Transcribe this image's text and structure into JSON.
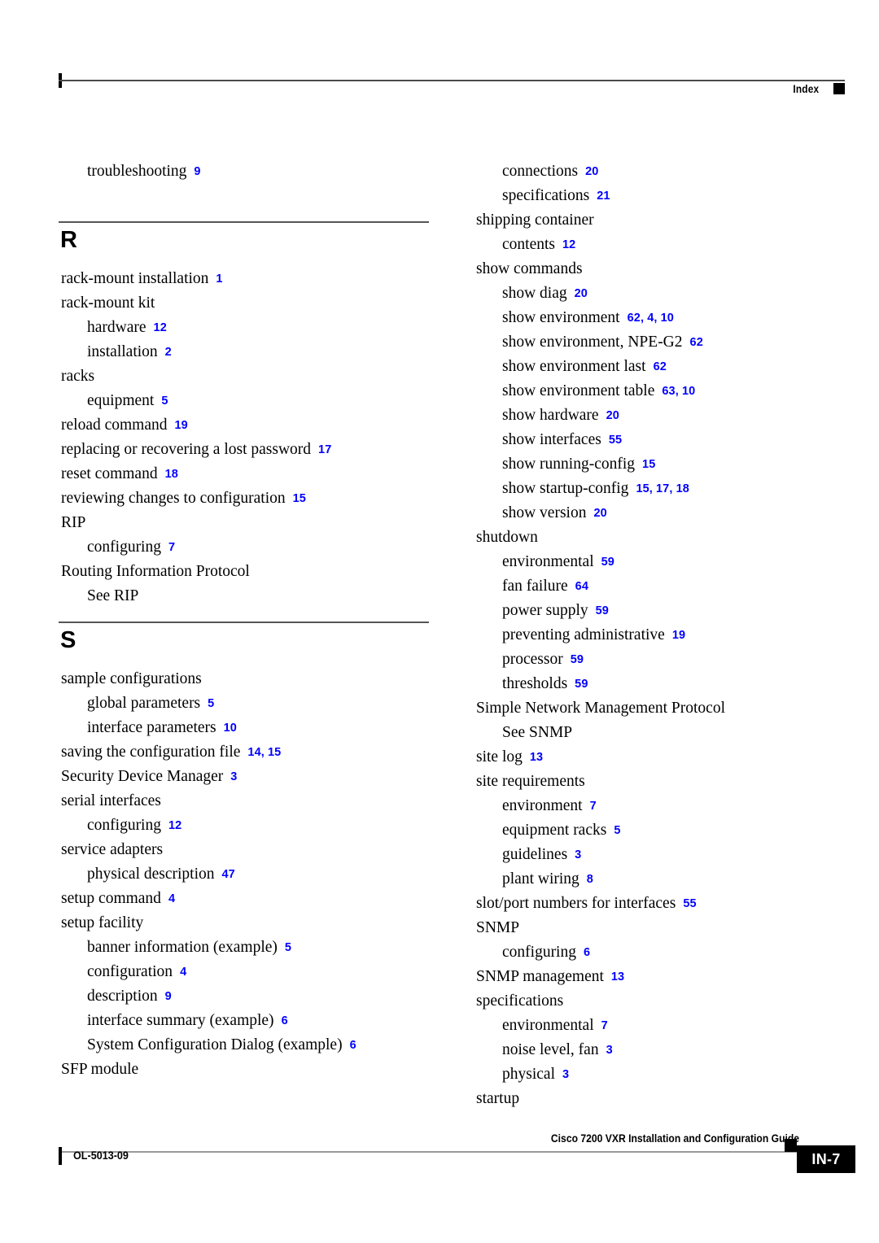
{
  "header": {
    "label": "Index"
  },
  "footer": {
    "guide_title": "Cisco 7200 VXR Installation and Configuration Guide",
    "doc_number": "OL-5013-09",
    "page_number": "IN-7"
  },
  "columns": {
    "left": [
      {
        "kind": "entry",
        "level": 2,
        "term": "troubleshooting",
        "pages": "9"
      },
      {
        "kind": "spacer"
      },
      {
        "kind": "section",
        "letter": "R"
      },
      {
        "kind": "entry",
        "level": 1,
        "term": "rack-mount installation",
        "pages": "1"
      },
      {
        "kind": "entry",
        "level": 1,
        "term": "rack-mount kit",
        "pages": ""
      },
      {
        "kind": "entry",
        "level": 2,
        "term": "hardware",
        "pages": "12"
      },
      {
        "kind": "entry",
        "level": 2,
        "term": "installation",
        "pages": "2"
      },
      {
        "kind": "entry",
        "level": 1,
        "term": "racks",
        "pages": ""
      },
      {
        "kind": "entry",
        "level": 2,
        "term": "equipment",
        "pages": "5"
      },
      {
        "kind": "entry",
        "level": 1,
        "term": "reload command",
        "pages": "19"
      },
      {
        "kind": "entry",
        "level": 1,
        "term": "replacing or recovering a lost password",
        "pages": "17"
      },
      {
        "kind": "entry",
        "level": 1,
        "term": "reset command",
        "pages": "18"
      },
      {
        "kind": "entry",
        "level": 1,
        "term": "reviewing changes to configuration",
        "pages": "15"
      },
      {
        "kind": "entry",
        "level": 1,
        "term": "RIP",
        "pages": ""
      },
      {
        "kind": "entry",
        "level": 2,
        "term": "configuring",
        "pages": "7"
      },
      {
        "kind": "entry",
        "level": 1,
        "term": "Routing Information Protocol",
        "pages": ""
      },
      {
        "kind": "entry",
        "level": 2,
        "term": "See RIP",
        "pages": ""
      },
      {
        "kind": "section",
        "letter": "S"
      },
      {
        "kind": "entry",
        "level": 1,
        "term": "sample configurations",
        "pages": ""
      },
      {
        "kind": "entry",
        "level": 2,
        "term": "global parameters",
        "pages": "5"
      },
      {
        "kind": "entry",
        "level": 2,
        "term": "interface parameters",
        "pages": "10"
      },
      {
        "kind": "entry",
        "level": 1,
        "term": "saving the configuration file",
        "pages": "14, 15"
      },
      {
        "kind": "entry",
        "level": 1,
        "term": "Security Device Manager",
        "pages": "3"
      },
      {
        "kind": "entry",
        "level": 1,
        "term": "serial interfaces",
        "pages": ""
      },
      {
        "kind": "entry",
        "level": 2,
        "term": "configuring",
        "pages": "12"
      },
      {
        "kind": "entry",
        "level": 1,
        "term": "service adapters",
        "pages": ""
      },
      {
        "kind": "entry",
        "level": 2,
        "term": "physical description",
        "pages": "47"
      },
      {
        "kind": "entry",
        "level": 1,
        "term": "setup command",
        "pages": "4"
      },
      {
        "kind": "entry",
        "level": 1,
        "term": "setup facility",
        "pages": ""
      },
      {
        "kind": "entry",
        "level": 2,
        "term": "banner information (example)",
        "pages": "5"
      },
      {
        "kind": "entry",
        "level": 2,
        "term": "configuration",
        "pages": "4"
      },
      {
        "kind": "entry",
        "level": 2,
        "term": "description",
        "pages": "9"
      },
      {
        "kind": "entry",
        "level": 2,
        "term": "interface summary (example)",
        "pages": "6"
      },
      {
        "kind": "entry",
        "level": 2,
        "term": "System Configuration Dialog (example)",
        "pages": "6"
      },
      {
        "kind": "entry",
        "level": 1,
        "term": "SFP module",
        "pages": ""
      }
    ],
    "right": [
      {
        "kind": "entry",
        "level": 2,
        "term": "connections",
        "pages": "20"
      },
      {
        "kind": "entry",
        "level": 2,
        "term": "specifications",
        "pages": "21"
      },
      {
        "kind": "entry",
        "level": 1,
        "term": "shipping container",
        "pages": ""
      },
      {
        "kind": "entry",
        "level": 2,
        "term": "contents",
        "pages": "12"
      },
      {
        "kind": "entry",
        "level": 1,
        "term": "show commands",
        "pages": ""
      },
      {
        "kind": "entry",
        "level": 2,
        "term": "show diag",
        "pages": "20"
      },
      {
        "kind": "entry",
        "level": 2,
        "term": "show environment",
        "pages": "62, 4, 10"
      },
      {
        "kind": "entry",
        "level": 2,
        "term": "show environment, NPE-G2",
        "pages": "62"
      },
      {
        "kind": "entry",
        "level": 2,
        "term": "show environment last",
        "pages": "62"
      },
      {
        "kind": "entry",
        "level": 2,
        "term": "show environment table",
        "pages": "63, 10"
      },
      {
        "kind": "entry",
        "level": 2,
        "term": "show hardware",
        "pages": "20"
      },
      {
        "kind": "entry",
        "level": 2,
        "term": "show interfaces",
        "pages": "55"
      },
      {
        "kind": "entry",
        "level": 2,
        "term": "show running-config",
        "pages": "15"
      },
      {
        "kind": "entry",
        "level": 2,
        "term": "show startup-config",
        "pages": "15, 17, 18"
      },
      {
        "kind": "entry",
        "level": 2,
        "term": "show version",
        "pages": "20"
      },
      {
        "kind": "entry",
        "level": 1,
        "term": "shutdown",
        "pages": ""
      },
      {
        "kind": "entry",
        "level": 2,
        "term": "environmental",
        "pages": "59"
      },
      {
        "kind": "entry",
        "level": 2,
        "term": "fan failure",
        "pages": "64"
      },
      {
        "kind": "entry",
        "level": 2,
        "term": "power supply",
        "pages": "59"
      },
      {
        "kind": "entry",
        "level": 2,
        "term": "preventing administrative",
        "pages": "19"
      },
      {
        "kind": "entry",
        "level": 2,
        "term": "processor",
        "pages": "59"
      },
      {
        "kind": "entry",
        "level": 2,
        "term": "thresholds",
        "pages": "59"
      },
      {
        "kind": "entry",
        "level": 1,
        "term": "Simple Network Management Protocol",
        "pages": ""
      },
      {
        "kind": "entry",
        "level": 2,
        "term": "See SNMP",
        "pages": ""
      },
      {
        "kind": "entry",
        "level": 1,
        "term": "site log",
        "pages": "13"
      },
      {
        "kind": "entry",
        "level": 1,
        "term": "site requirements",
        "pages": ""
      },
      {
        "kind": "entry",
        "level": 2,
        "term": "environment",
        "pages": "7"
      },
      {
        "kind": "entry",
        "level": 2,
        "term": "equipment racks",
        "pages": "5"
      },
      {
        "kind": "entry",
        "level": 2,
        "term": "guidelines",
        "pages": "3"
      },
      {
        "kind": "entry",
        "level": 2,
        "term": "plant wiring",
        "pages": "8"
      },
      {
        "kind": "entry",
        "level": 1,
        "term": "slot/port numbers for interfaces",
        "pages": "55"
      },
      {
        "kind": "entry",
        "level": 1,
        "term": "SNMP",
        "pages": ""
      },
      {
        "kind": "entry",
        "level": 2,
        "term": "configuring",
        "pages": "6"
      },
      {
        "kind": "entry",
        "level": 1,
        "term": "SNMP management",
        "pages": "13"
      },
      {
        "kind": "entry",
        "level": 1,
        "term": "specifications",
        "pages": ""
      },
      {
        "kind": "entry",
        "level": 2,
        "term": "environmental",
        "pages": "7"
      },
      {
        "kind": "entry",
        "level": 2,
        "term": "noise level, fan",
        "pages": "3"
      },
      {
        "kind": "entry",
        "level": 2,
        "term": "physical",
        "pages": "3"
      },
      {
        "kind": "entry",
        "level": 1,
        "term": "startup",
        "pages": ""
      }
    ]
  }
}
